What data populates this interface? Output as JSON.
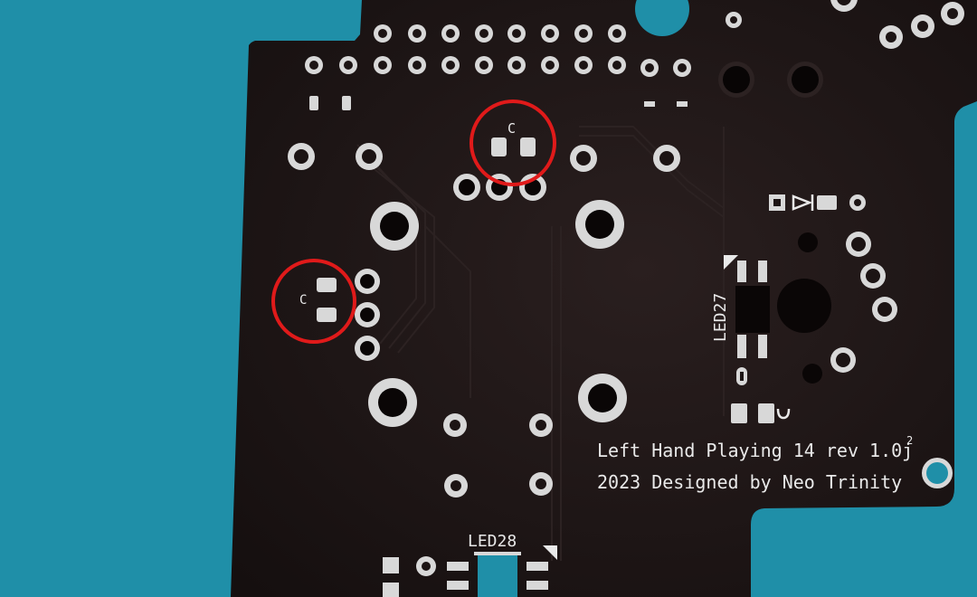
{
  "photo": {
    "background_color": "#1f8fa8",
    "board_color": "#1c1414",
    "silkscreen_color": "#e9e9e9",
    "highlight_color": "#e01a1a"
  },
  "silkscreen": {
    "title_line": "Left Hand Playing 14  rev 1.0j",
    "title_superscript": "2",
    "credit_line": "2023  Designed by Neo Trinity",
    "led27_label": "LED27",
    "led28_label": "LED28",
    "cap_top_label": "C",
    "cap_left_label": "C"
  },
  "annotations": [
    {
      "name": "circle-around-capacitor-top",
      "target": "cap_top_label"
    },
    {
      "name": "circle-around-capacitor-left",
      "target": "cap_left_label"
    }
  ]
}
